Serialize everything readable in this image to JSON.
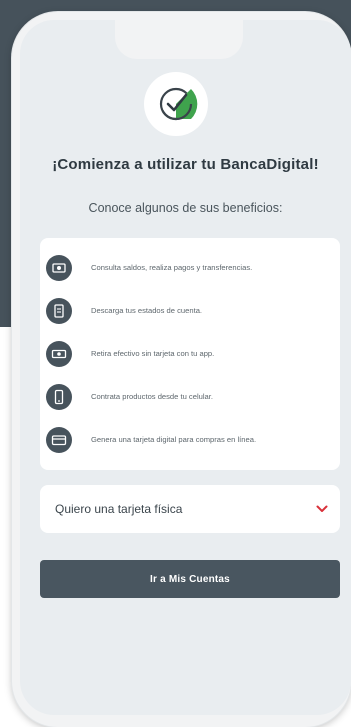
{
  "title": "¡Comienza a utilizar tu BancaDigital!",
  "subtitle": "Conoce algunos de sus beneficios:",
  "benefits": [
    {
      "icon": "money-transfer-icon",
      "text": "Consulta saldos, realiza pagos y transferencias."
    },
    {
      "icon": "document-icon",
      "text": "Descarga tus estados de cuenta."
    },
    {
      "icon": "cash-icon",
      "text": "Retira efectivo sin tarjeta con tu app."
    },
    {
      "icon": "mobile-icon",
      "text": "Contrata productos desde tu celular."
    },
    {
      "icon": "card-icon",
      "text": "Genera una tarjeta digital para compras en línea."
    }
  ],
  "dropdown": {
    "label": "Quiero una tarjeta física",
    "icon": "chevron-down-icon"
  },
  "cta": {
    "label": "Ir a Mis Cuentas"
  },
  "colors": {
    "background_dark": "#46525b",
    "accent_green": "#3fa34d",
    "dropdown_chevron": "#d9313a",
    "button": "#495660"
  }
}
